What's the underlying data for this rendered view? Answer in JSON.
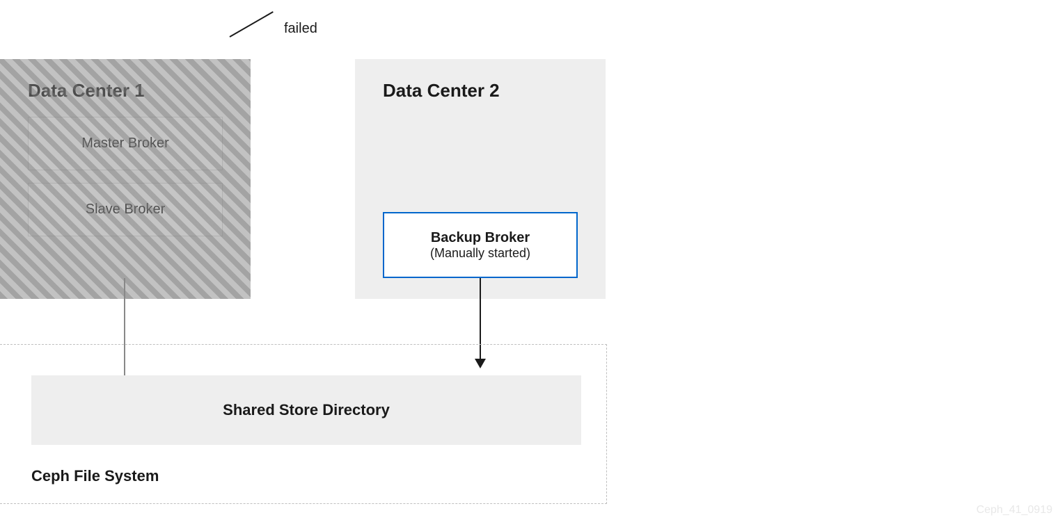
{
  "failed_label": "failed",
  "dc1": {
    "title": "Data Center 1",
    "master": "Master Broker",
    "slave": "Slave Broker"
  },
  "dc2": {
    "title": "Data Center 2",
    "backup_title": "Backup Broker",
    "backup_sub": "(Manually started)"
  },
  "shared_store": "Shared Store Directory",
  "ceph_label": "Ceph File System",
  "watermark": "Ceph_41_0919"
}
